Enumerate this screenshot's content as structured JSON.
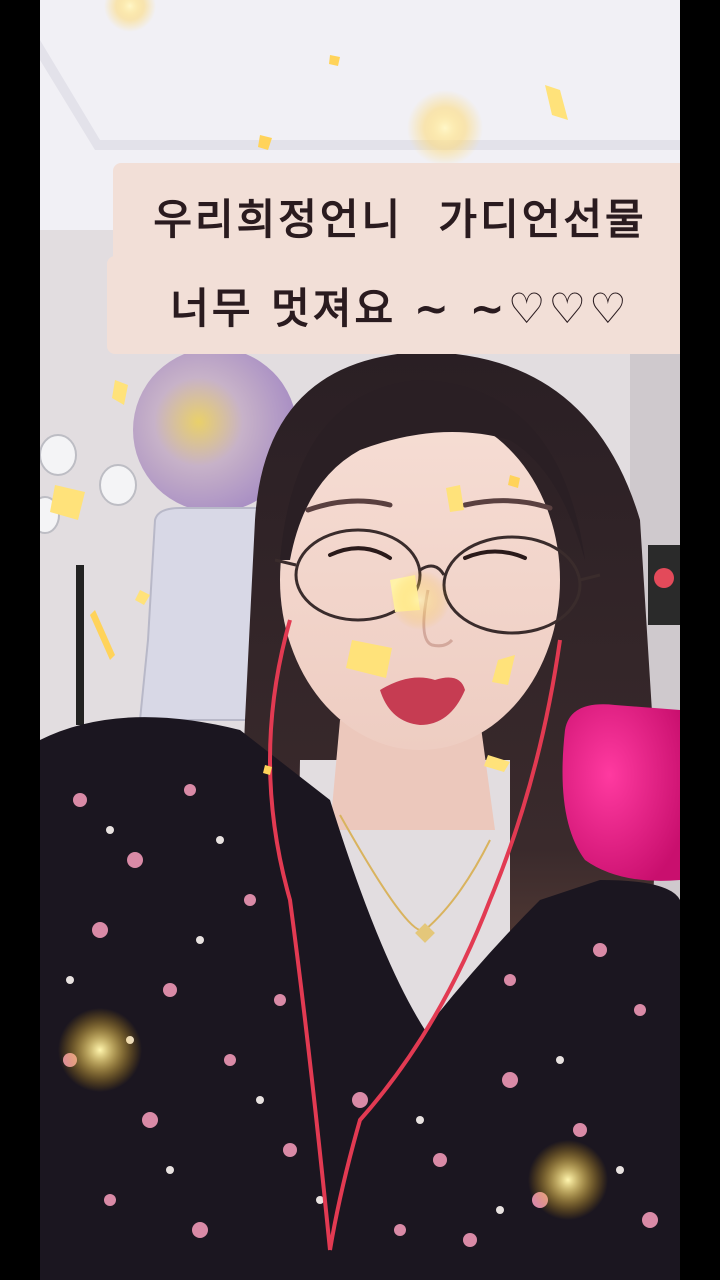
{
  "captions": [
    "우리희정언니  가디언선물",
    "너무 멋져요 ~ ~♡♡♡"
  ],
  "colors": {
    "caption_background": "#f2dfd7",
    "caption_text": "#2a1b1f",
    "microphone": "#e0157f",
    "letterbox": "#000000"
  }
}
